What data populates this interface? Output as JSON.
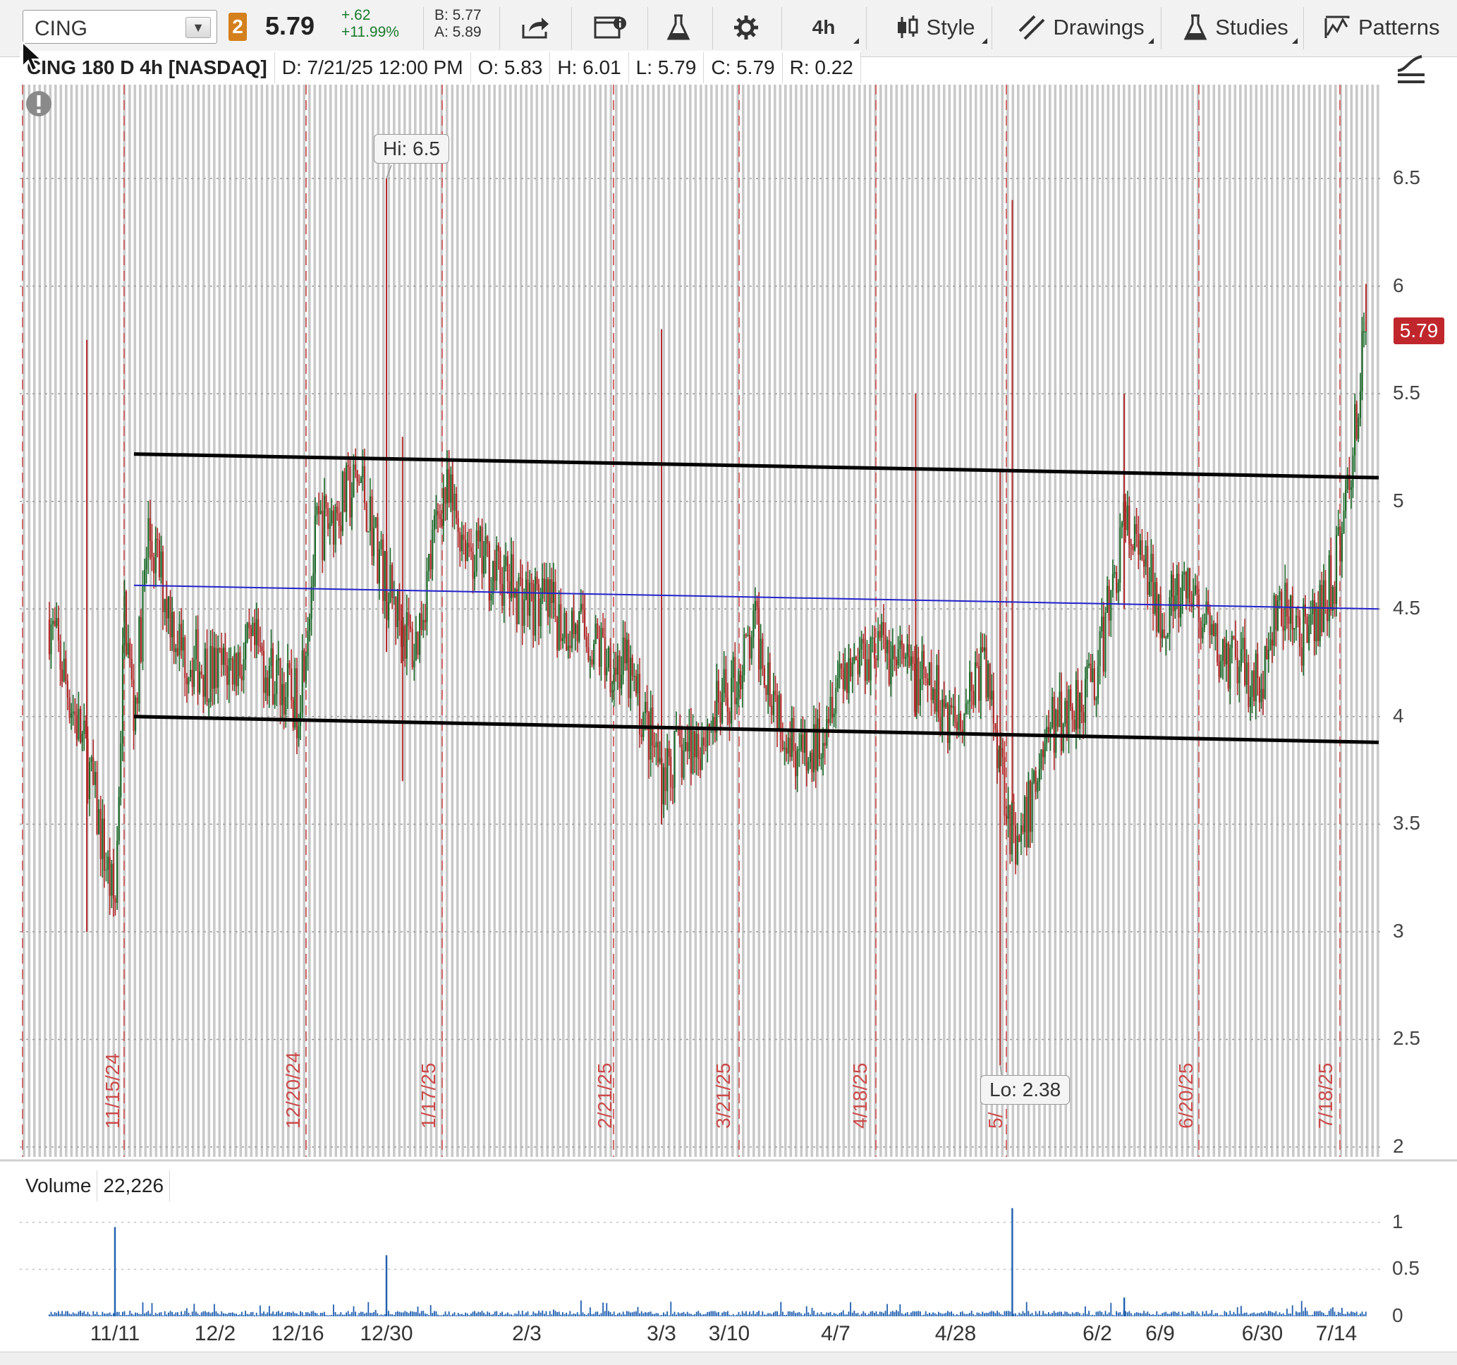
{
  "toolbar": {
    "symbol": "CING",
    "link_group": "2",
    "last_price": "5.79",
    "net_change": "+.62",
    "pct_change": "+11.99%",
    "bid": "B: 5.77",
    "ask": "A: 5.89",
    "aggregation": "4h",
    "style_label": "Style",
    "drawings_label": "Drawings",
    "studies_label": "Studies",
    "patterns_label": "Patterns"
  },
  "header": {
    "title": "CING 180 D 4h [NASDAQ]",
    "date": "D: 7/21/25 12:00 PM",
    "open": "O: 5.83",
    "high": "H: 6.01",
    "low": "L: 5.79",
    "close": "C: 5.79",
    "range": "R: 0.22"
  },
  "price_axis": [
    "6.5",
    "6",
    "5.5",
    "5",
    "4.5",
    "4",
    "3.5",
    "3",
    "2.5",
    "2"
  ],
  "last_price_tag": "5.79",
  "hi_tooltip": "Hi: 6.5",
  "lo_tooltip": "Lo: 2.38",
  "rotated_dates": [
    "11/15/24",
    "12/20/24",
    "1/17/25",
    "2/21/25",
    "3/21/25",
    "4/18/25",
    "5/",
    "6/20/25",
    "7/18/25"
  ],
  "volume": {
    "label": "Volume",
    "value": "22,226",
    "axis": [
      "1",
      "0.5",
      "0"
    ]
  },
  "x_axis": [
    "11/11",
    "12/2",
    "12/16",
    "12/30",
    "2/3",
    "3/3",
    "3/10",
    "4/7",
    "4/28",
    "6/2",
    "6/9",
    "6/30",
    "7/14"
  ],
  "colors": {
    "up": "#1c6b2a",
    "down": "#b22a2a",
    "trendline": "#000000",
    "midline": "#2222cc",
    "volume": "#1f5fb0",
    "last_tag": "#c0272d"
  },
  "chart_data": {
    "type": "candlestick",
    "symbol": "CING",
    "aggregation": "4h",
    "ylim": [
      2,
      6.7
    ],
    "price_path_approx": [
      [
        "11/4",
        4.45
      ],
      [
        "11/8",
        3.8
      ],
      [
        "11/11",
        3.1
      ],
      [
        "11/13",
        4.5
      ],
      [
        "11/15",
        4.0
      ],
      [
        "11/18",
        4.85
      ],
      [
        "11/25",
        4.3
      ],
      [
        "12/2",
        4.2
      ],
      [
        "12/9",
        4.3
      ],
      [
        "12/16",
        4.05
      ],
      [
        "12/19",
        4.85
      ],
      [
        "12/26",
        5.1
      ],
      [
        "12/30",
        4.6
      ],
      [
        "1/6",
        4.3
      ],
      [
        "1/13",
        5.05
      ],
      [
        "1/21",
        4.75
      ],
      [
        "2/3",
        4.55
      ],
      [
        "2/14",
        4.4
      ],
      [
        "2/24",
        4.2
      ],
      [
        "3/3",
        3.75
      ],
      [
        "3/7",
        3.9
      ],
      [
        "3/10",
        4.1
      ],
      [
        "3/17",
        4.4
      ],
      [
        "3/24",
        4.0
      ],
      [
        "3/31",
        3.75
      ],
      [
        "4/7",
        4.2
      ],
      [
        "4/14",
        4.35
      ],
      [
        "4/28",
        4.0
      ],
      [
        "5/5",
        4.25
      ],
      [
        "5/9",
        3.85
      ],
      [
        "5/13",
        3.3
      ],
      [
        "5/20",
        3.9
      ],
      [
        "6/2",
        4.2
      ],
      [
        "6/5",
        4.9
      ],
      [
        "6/9",
        4.5
      ],
      [
        "6/16",
        4.55
      ],
      [
        "6/20",
        4.3
      ],
      [
        "6/30",
        4.15
      ],
      [
        "7/3",
        4.5
      ],
      [
        "7/9",
        4.35
      ],
      [
        "7/14",
        4.7
      ],
      [
        "7/17",
        5.1
      ],
      [
        "7/21",
        5.79
      ]
    ],
    "high": 6.5,
    "low": 2.38,
    "trendlines": [
      {
        "name": "upper",
        "from": [
          "11/15",
          5.22
        ],
        "to": [
          "7/24",
          5.11
        ]
      },
      {
        "name": "middle",
        "from": [
          "11/15",
          4.61
        ],
        "to": [
          "7/24",
          4.5
        ]
      },
      {
        "name": "lower",
        "from": [
          "11/15",
          4.0
        ],
        "to": [
          "7/24",
          3.88
        ]
      }
    ],
    "volume_peaks": [
      [
        "11/11",
        0.95
      ],
      [
        "12/30",
        0.65
      ],
      [
        "5/12",
        1.15
      ],
      [
        "6/5",
        0.2
      ]
    ],
    "volume_ylim": [
      0,
      1.2
    ]
  }
}
